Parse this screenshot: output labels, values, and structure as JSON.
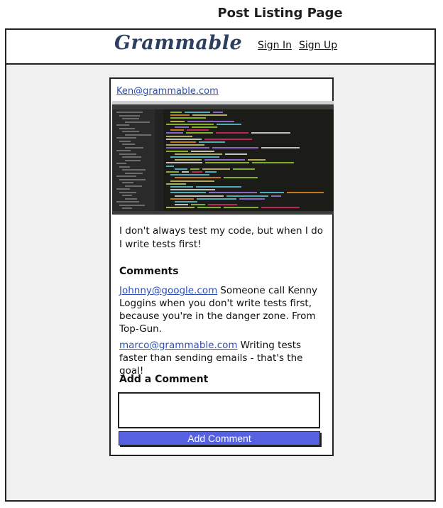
{
  "page": {
    "title": "Post Listing Page"
  },
  "navbar": {
    "logo_text": "Grammable",
    "links": [
      {
        "label": "Sign In"
      },
      {
        "label": "Sign Up"
      }
    ]
  },
  "post": {
    "author": "Ken@grammable.com",
    "caption": "I don't always test my code, but when I do I write tests first!",
    "comments_heading": "Comments",
    "comments": [
      {
        "author": "Johnny@google.com",
        "text": "Someone call Kenny Loggins when you don't write tests first, because you're in the danger zone. From Top-Gun."
      },
      {
        "author": "marco@grammable.com",
        "text": "Writing tests faster than sending emails - that's the goal!"
      }
    ],
    "add_comment_heading": "Add a Comment",
    "comment_input_value": "",
    "add_comment_button": "Add Comment"
  }
}
